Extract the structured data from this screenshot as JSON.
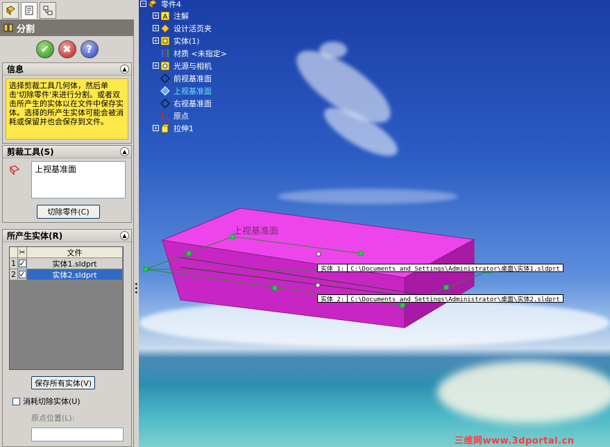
{
  "panel": {
    "title": "分割",
    "tabs": [
      "feature-manager-tab",
      "property-manager-tab",
      "configuration-manager-tab"
    ],
    "actions": {
      "ok": "✔",
      "cancel": "✖",
      "help": "?"
    }
  },
  "info": {
    "header": "信息",
    "text": "选择剪裁工具几何体，然后单击'切除零件'来进行分割。或者双击所产生的实体以在文件中保存实体。选择的所产生实体可能会被消耗或保留并也会保存到文件。"
  },
  "trim_tools": {
    "header": "剪裁工具(S)",
    "selected": "上视基准面",
    "cut_button": "切除零件(C)"
  },
  "resulting_bodies": {
    "header": "所产生实体(R)",
    "columns": {
      "check": "✂",
      "file": "文件"
    },
    "rows": [
      {
        "num": "1",
        "file": "实体1.sldprt"
      },
      {
        "num": "2",
        "file": "实体2.sldprt"
      }
    ],
    "save_all": "保存所有实体(V)",
    "consume_label": "消耗切除实体(U)",
    "origin_label": "原点位置(L):"
  },
  "tree": {
    "root": "零件4",
    "items": [
      {
        "label": "注解",
        "icon": "annotation-icon"
      },
      {
        "label": "设计活页夹",
        "icon": "design-binder-icon"
      },
      {
        "label": "实体(1)",
        "icon": "solid-bodies-icon"
      },
      {
        "label": "材质 <未指定>",
        "icon": "material-icon"
      },
      {
        "label": "光源与相机",
        "icon": "lights-cameras-icon"
      },
      {
        "label": "前视基准面",
        "icon": "plane-icon"
      },
      {
        "label": "上视基准面",
        "icon": "plane-icon"
      },
      {
        "label": "右视基准面",
        "icon": "plane-icon"
      },
      {
        "label": "原点",
        "icon": "origin-icon"
      },
      {
        "label": "拉伸1",
        "icon": "extrude-icon"
      }
    ]
  },
  "viewport": {
    "plane_label": "上视基准面",
    "callouts": [
      {
        "left": "实体  1:",
        "right": "C:\\Documents and Settings\\Administrator\\桌面\\实体1.sldprt"
      },
      {
        "left": "实体  2:",
        "right": "C:\\Documents and Settings\\Administrator\\桌面\\实体2.sldprt"
      }
    ],
    "watermark": "三维网www.3dportal.cn"
  },
  "colors": {
    "body": "#e23be0",
    "panel_title": "#7a7670",
    "selection": "#316ac5",
    "info_bg": "#ffe84a"
  }
}
